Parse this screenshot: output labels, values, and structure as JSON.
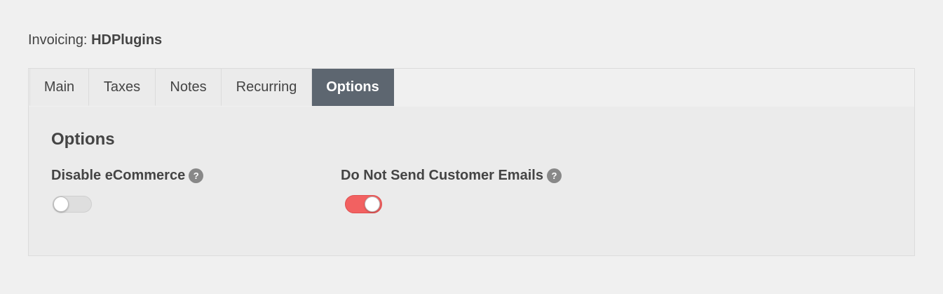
{
  "heading": {
    "prefix": "Invoicing:",
    "name": "HDPlugins"
  },
  "tabs": [
    {
      "label": "Main",
      "active": false
    },
    {
      "label": "Taxes",
      "active": false
    },
    {
      "label": "Notes",
      "active": false
    },
    {
      "label": "Recurring",
      "active": false
    },
    {
      "label": "Options",
      "active": true
    }
  ],
  "section": {
    "title": "Options"
  },
  "options": [
    {
      "label": "Disable eCommerce",
      "help": "?",
      "enabled": false
    },
    {
      "label": "Do Not Send Customer Emails",
      "help": "?",
      "enabled": true
    }
  ],
  "colors": {
    "toggle_on": "#f26161",
    "toggle_off": "#dedede",
    "active_tab": "#5d6670",
    "help_icon": "#888888"
  }
}
